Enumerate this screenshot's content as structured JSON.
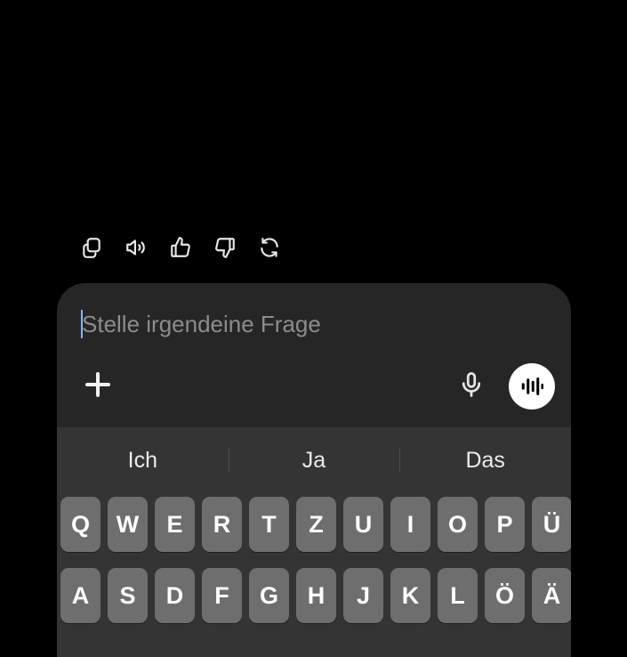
{
  "action_bar": {
    "icons": [
      "copy-icon",
      "speaker-icon",
      "thumbs-up-icon",
      "thumbs-down-icon",
      "regenerate-icon"
    ]
  },
  "composer": {
    "placeholder": "Stelle irgendeine Frage",
    "value": "",
    "plus_icon": "plus-icon",
    "mic_icon": "microphone-icon",
    "voice_icon": "voice-waveform-icon"
  },
  "keyboard": {
    "suggestions": [
      "Ich",
      "Ja",
      "Das"
    ],
    "row1": [
      "Q",
      "W",
      "E",
      "R",
      "T",
      "Z",
      "U",
      "I",
      "O",
      "P",
      "Ü"
    ],
    "row2": [
      "A",
      "S",
      "D",
      "F",
      "G",
      "H",
      "J",
      "K",
      "L",
      "Ö",
      "Ä"
    ]
  },
  "colors": {
    "background": "#000000",
    "panel": "#262626",
    "keyboard": "#343434",
    "key": "#6e6e6e"
  }
}
